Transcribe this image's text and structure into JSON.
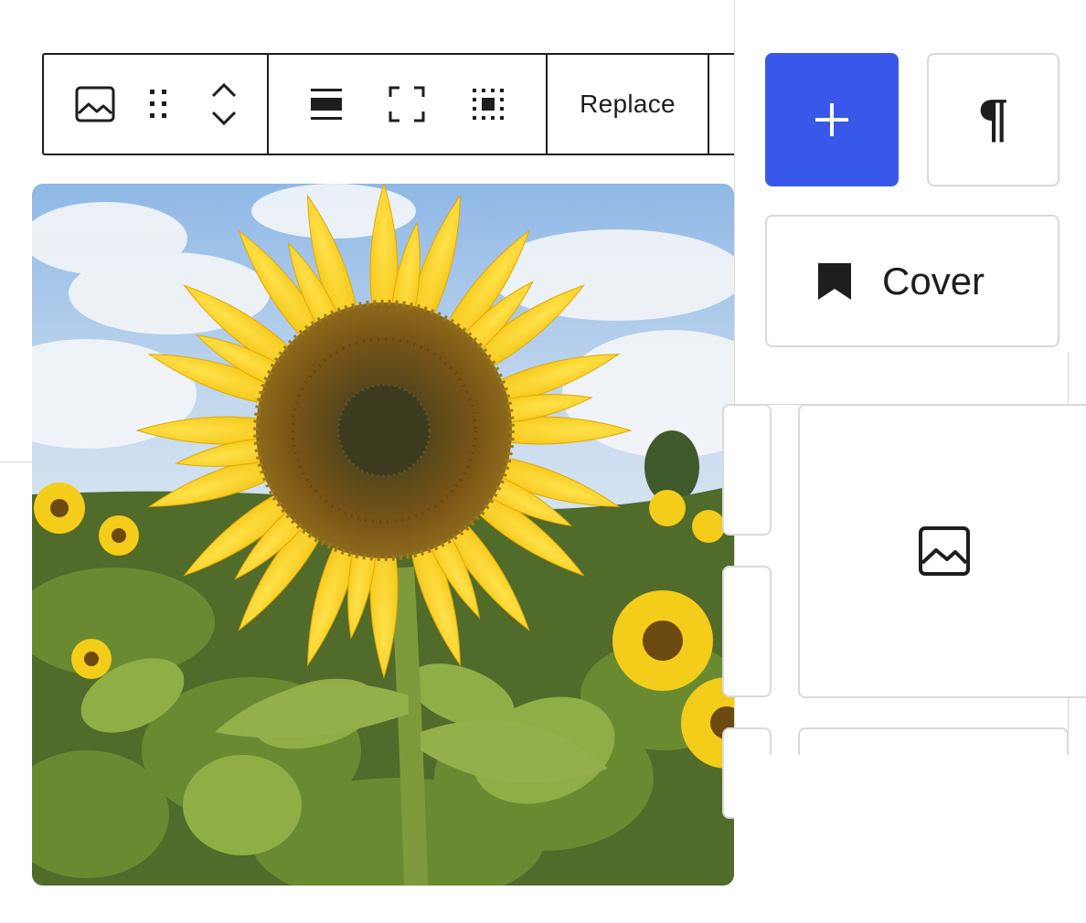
{
  "toolbar": {
    "block_icon": "image-icon",
    "drag_icon": "drag-handle-icon",
    "move_icon": "chevron-up-down-icon",
    "align_icon": "align-wide-icon",
    "fullwidth_icon": "fullscreen-icon",
    "focal_icon": "focal-point-icon",
    "replace_label": "Replace"
  },
  "image": {
    "subject": "sunflower-photo"
  },
  "inserter": {
    "add_icon": "plus-icon",
    "paragraph_glyph": "¶",
    "cover_icon": "bookmark-icon",
    "cover_label": "Cover",
    "image_card_icon": "image-icon"
  },
  "colors": {
    "accent": "#3858e9",
    "text": "#1e1e1e",
    "border": "#d9d9dd"
  }
}
